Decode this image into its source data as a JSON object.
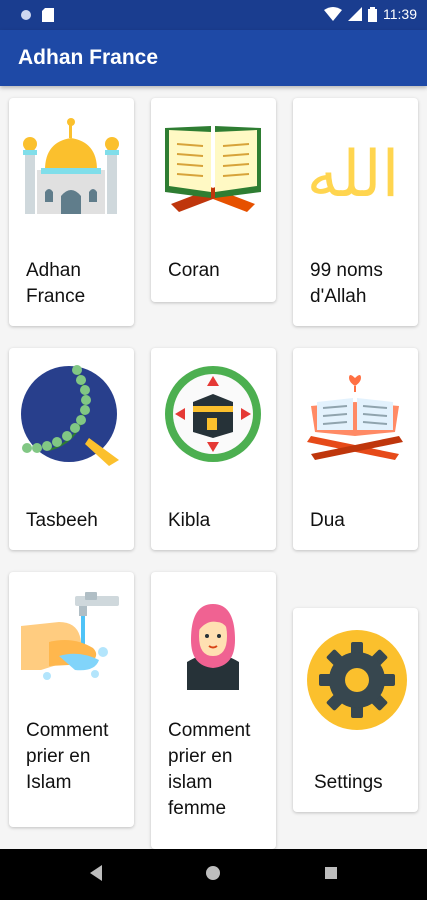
{
  "status_bar": {
    "time": "11:39"
  },
  "app_bar": {
    "title": "Adhan France"
  },
  "menu": [
    {
      "label": "Adhan France"
    },
    {
      "label": "Coran"
    },
    {
      "label": "99 noms d'Allah",
      "arabic_text": "الله"
    },
    {
      "label": "Tasbeeh"
    },
    {
      "label": "Kibla"
    },
    {
      "label": "Dua"
    },
    {
      "label": "Comment prier en Islam"
    },
    {
      "label": "Comment prier en islam femme"
    },
    {
      "label": "Settings"
    }
  ],
  "icons": {
    "mosque": "mosque-icon",
    "quran": "quran-book-icon",
    "allah": "allah-calligraphy-icon",
    "tasbeeh": "prayer-beads-icon",
    "kibla": "kaaba-compass-icon",
    "dua": "open-book-stand-icon",
    "prayer": "ablution-hands-icon",
    "woman": "hijab-woman-icon",
    "settings": "gear-icon"
  },
  "colors": {
    "app_bar": "#1e49a6",
    "status_bar": "#1a3d8f",
    "background": "#f5f5f5"
  }
}
